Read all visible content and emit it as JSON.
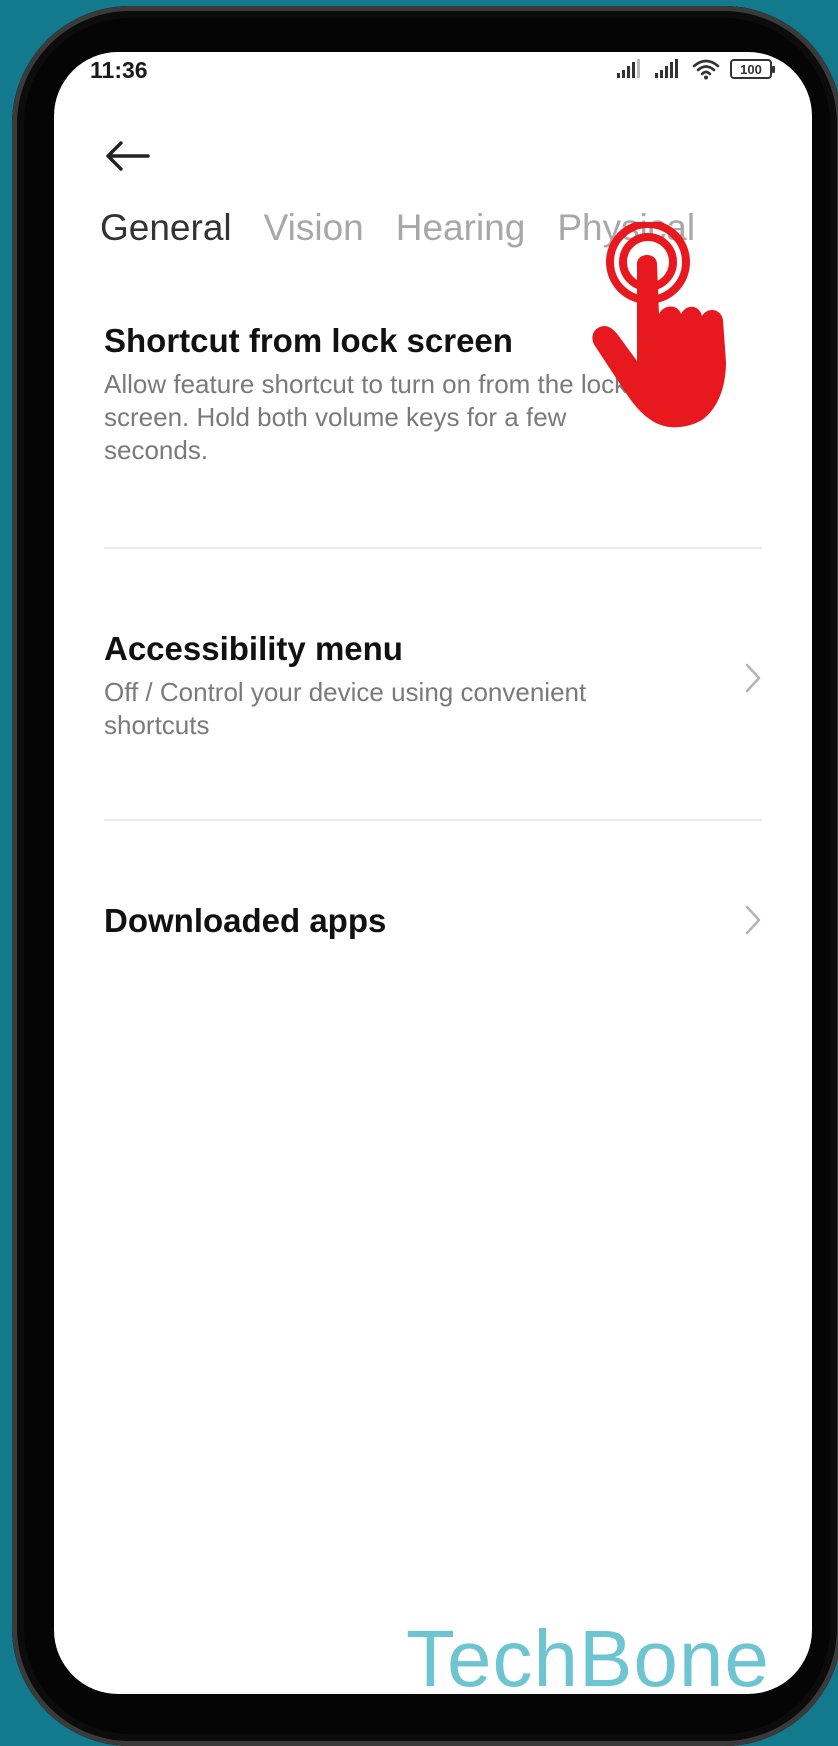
{
  "status_bar": {
    "time": "11:36",
    "battery": "100",
    "icons": [
      "signal-icon",
      "signal-icon",
      "wifi-icon",
      "battery-icon"
    ]
  },
  "toolbar": {
    "back_icon": "arrow-left-icon"
  },
  "tabs": [
    {
      "label": "General",
      "active": true
    },
    {
      "label": "Vision",
      "active": false
    },
    {
      "label": "Hearing",
      "active": false
    },
    {
      "label": "Physical",
      "active": false
    }
  ],
  "settings": [
    {
      "title": "Shortcut from lock screen",
      "description": "Allow feature shortcut to turn on from the lock screen. Hold both volume keys for a few seconds."
    },
    {
      "title": "Accessibility menu",
      "description": "Off / Control your device using convenient shortcuts",
      "icon": "chevron-right-icon"
    },
    {
      "title": "Downloaded apps",
      "icon": "chevron-right-icon"
    }
  ],
  "overlay": {
    "tap_indicator_icon": "tap-hand-icon",
    "tap_color": "#e8191e"
  },
  "watermark": "TechBone",
  "colors": {
    "background": "#127a8c",
    "watermark": "#6cc5d0",
    "tab_active": "#333333",
    "tab_inactive": "#a8a8a8"
  }
}
